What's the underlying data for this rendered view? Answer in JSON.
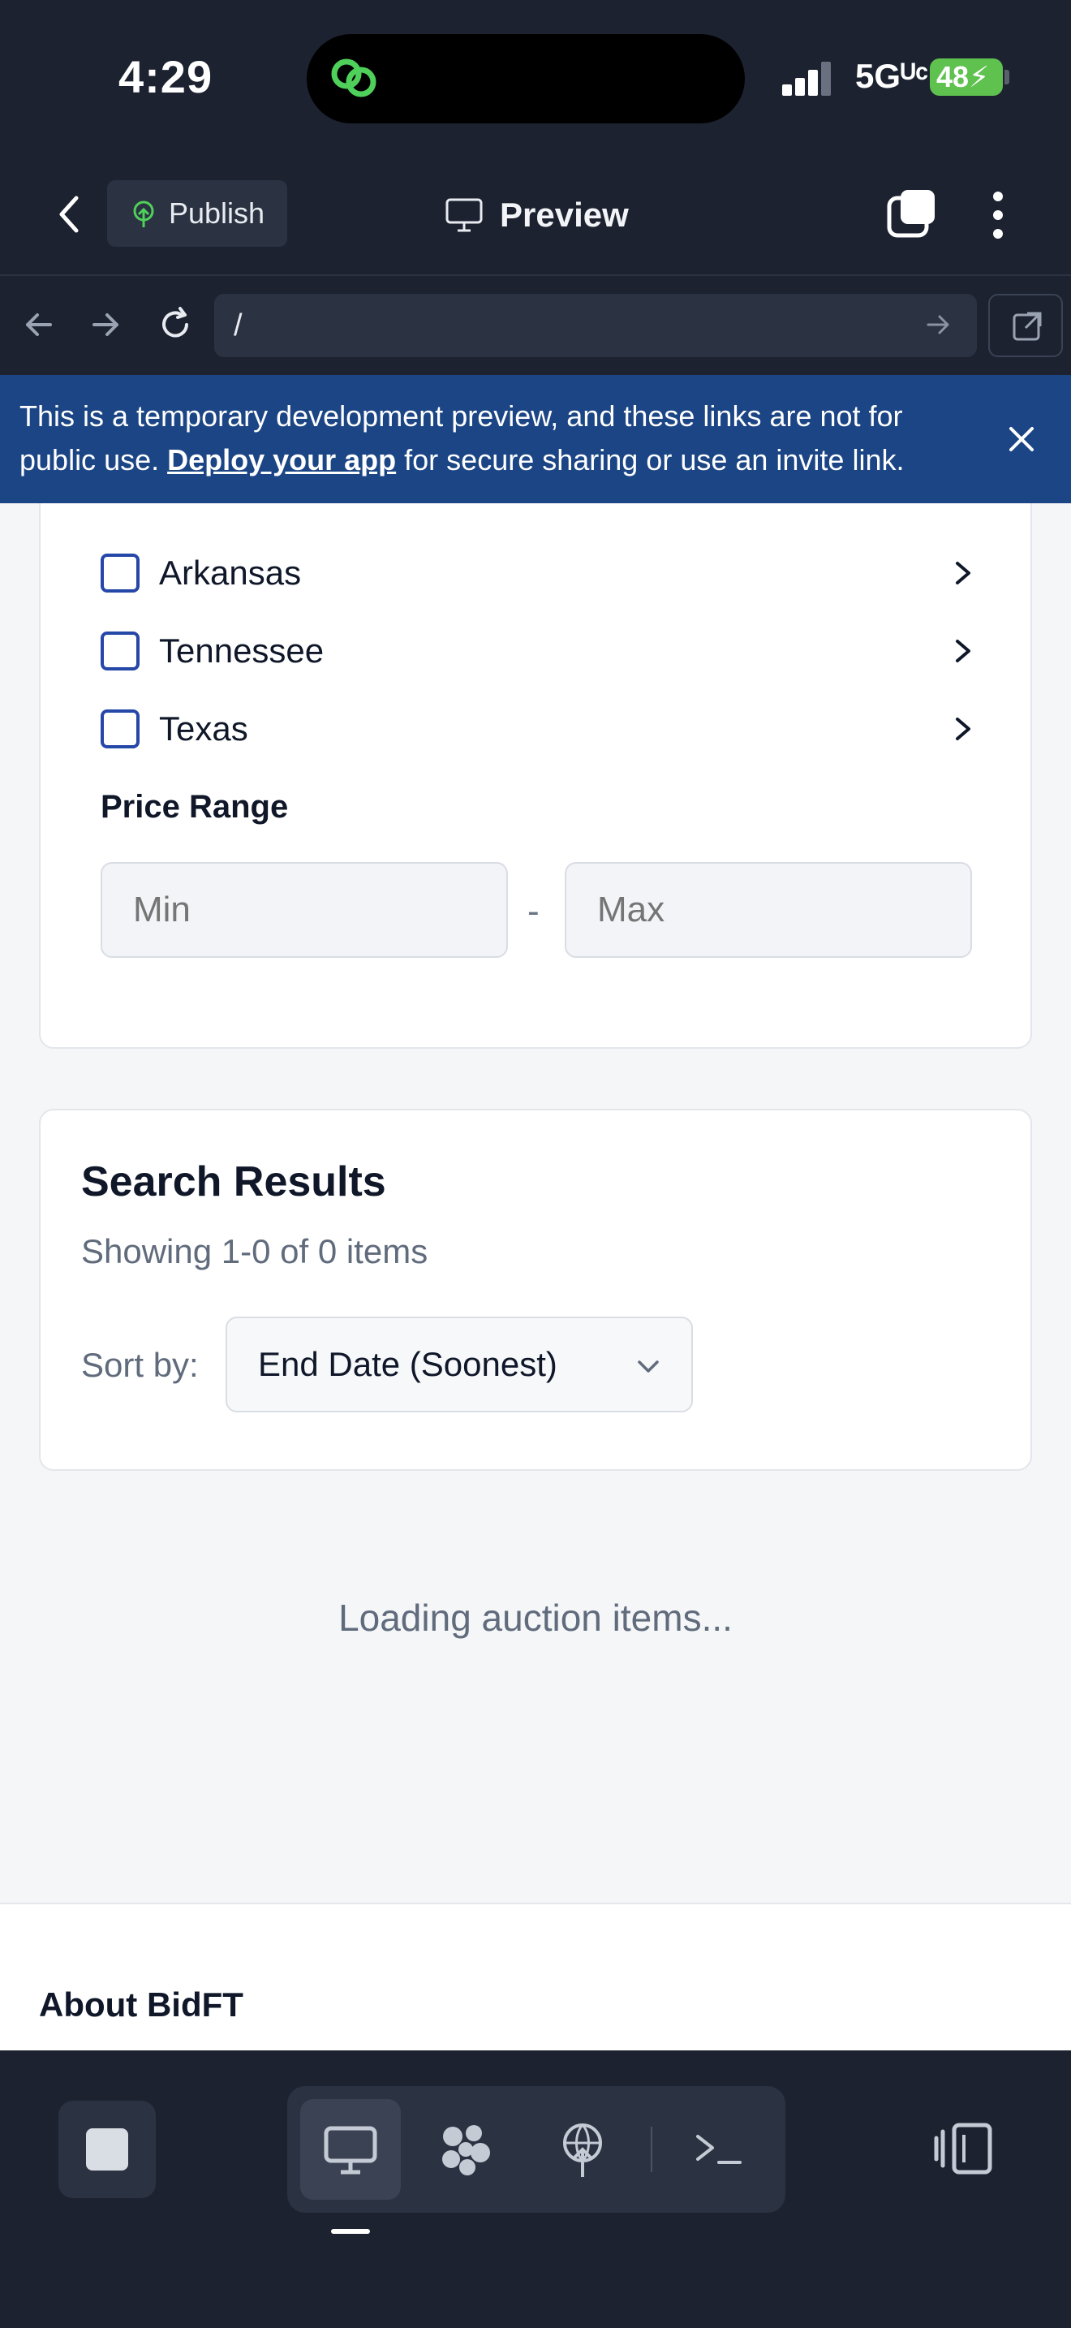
{
  "status_bar": {
    "time": "4:29",
    "network": "5Gᵁᶜ",
    "battery": "48"
  },
  "header": {
    "publish_label": "Publish",
    "title": "Preview"
  },
  "url_bar": {
    "url": "/"
  },
  "banner": {
    "text_before": "This is a temporary development preview, and these links are not for public use. ",
    "link_text": "Deploy your app",
    "text_after": " for secure sharing or use an invite link."
  },
  "filters": {
    "states": [
      {
        "label": "Arkansas",
        "checked": false
      },
      {
        "label": "Tennessee",
        "checked": false
      },
      {
        "label": "Texas",
        "checked": false
      }
    ],
    "price_range_label": "Price Range",
    "min_placeholder": "Min",
    "separator": "-",
    "max_placeholder": "Max"
  },
  "results": {
    "title": "Search Results",
    "summary": "Showing 1-0 of 0 items",
    "sort_label": "Sort by:",
    "sort_value": "End Date (Soonest)"
  },
  "loading_text": "Loading auction items...",
  "footer": {
    "title": "About BidFT"
  },
  "colors": {
    "banner_bg": "#1b4585",
    "checkbox_border": "#2447a8",
    "chrome_bg": "#1c2230",
    "battery": "#5fc24f"
  },
  "icons": {
    "back": "chevron-left-icon",
    "publish": "publish-icon",
    "preview": "monitor-icon",
    "tabs": "tabs-icon",
    "more": "more-vertical-icon",
    "close": "close-icon",
    "toolbar": [
      "stop-icon",
      "monitor-icon",
      "agent-icon",
      "deploy-icon",
      "terminal-icon",
      "panel-icon"
    ]
  }
}
